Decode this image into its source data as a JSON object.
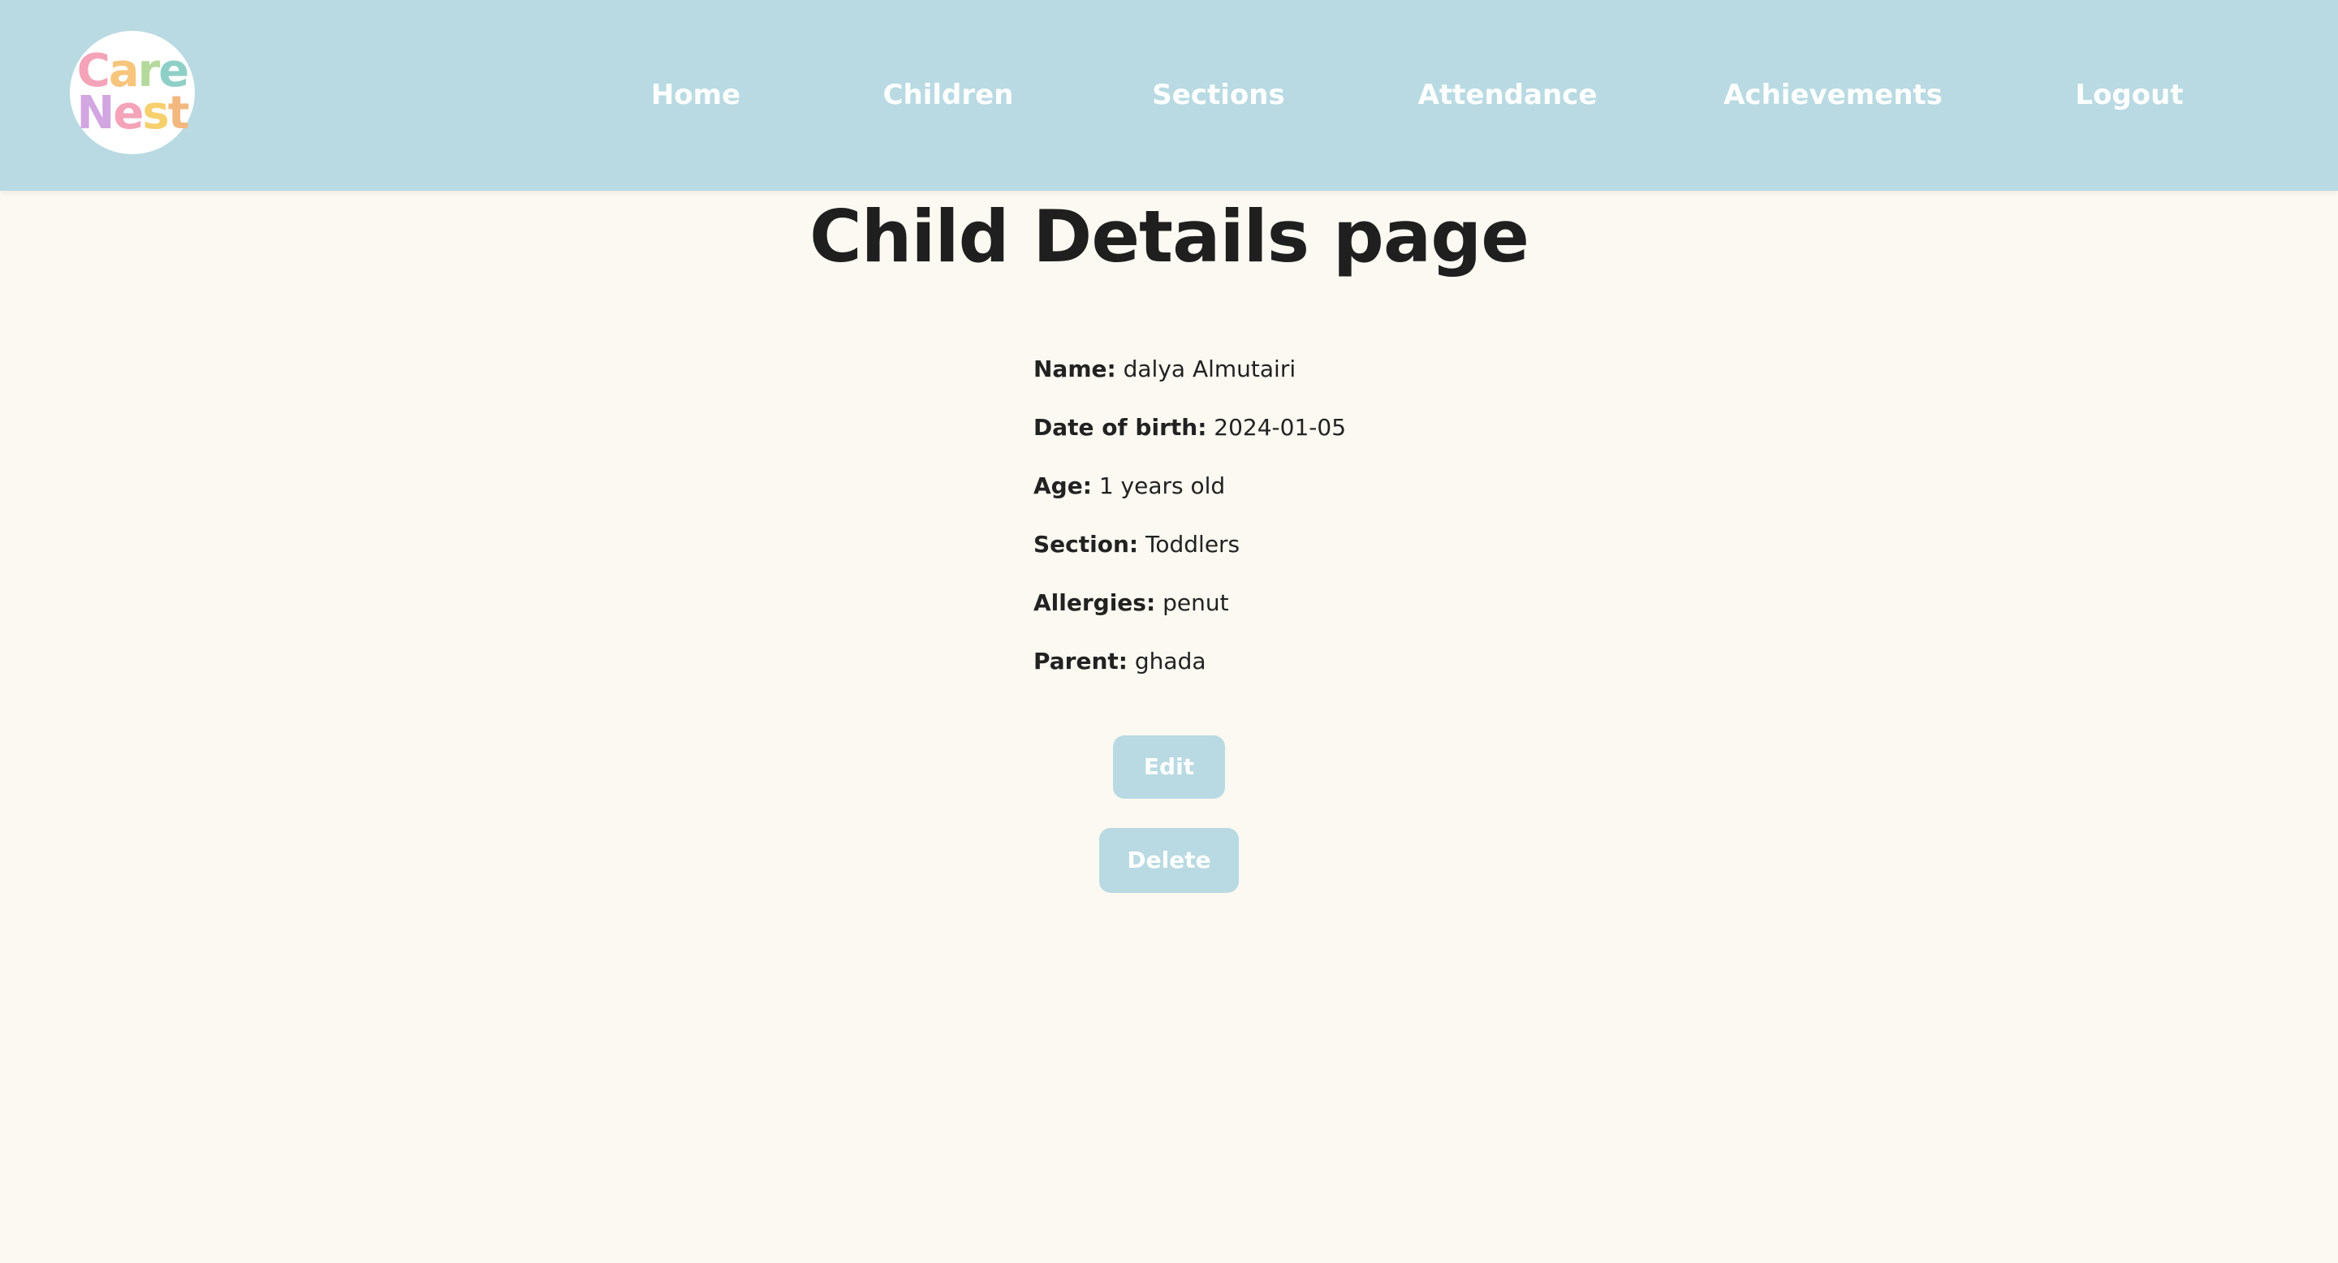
{
  "logo": {
    "line1": [
      "C",
      "a",
      "r",
      "e"
    ],
    "line2": [
      "N",
      "e",
      "s",
      "t"
    ],
    "colors": [
      "#f4a3b8",
      "#f7c67c",
      "#b5d99c",
      "#8fd0c6",
      "#d2a6e0",
      "#f4a3b8",
      "#f7d06e",
      "#f2b880"
    ]
  },
  "nav": {
    "home": "Home",
    "children": "Children",
    "sections": "Sections",
    "attendance": "Attendance",
    "achievements": "Achievements",
    "logout": "Logout"
  },
  "page_title": "Child Details page",
  "details": {
    "name_label": "Name:",
    "name_value": "dalya Almutairi",
    "dob_label": "Date of birth:",
    "dob_value": "2024-01-05",
    "age_label": "Age:",
    "age_value": "1 years old",
    "section_label": "Section:",
    "section_value": "Toddlers",
    "allergies_label": "Allergies:",
    "allergies_value": "penut",
    "parent_label": "Parent:",
    "parent_value": "ghada"
  },
  "actions": {
    "edit": "Edit",
    "delete": "Delete"
  },
  "colors": {
    "navbar": "#b9dae2",
    "background": "#fcf9f2",
    "button": "#b9dae2"
  }
}
